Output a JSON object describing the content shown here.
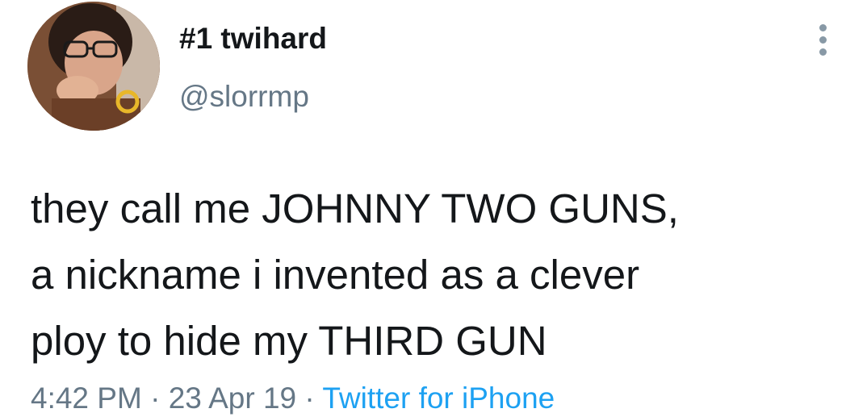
{
  "user": {
    "display_name": "#1 twihard",
    "handle": "@slorrmp",
    "avatar_icon": "user-avatar-photo"
  },
  "tweet": {
    "lines": [
      "they call me JOHNNY TWO GUNS,",
      "a nickname i invented as a clever",
      "ploy to hide my THIRD GUN"
    ],
    "time": "4:42 PM",
    "separator": "·",
    "date": "23 Apr 19",
    "source": "Twitter for iPhone"
  },
  "icons": {
    "more": "vertical-ellipsis-icon"
  },
  "colors": {
    "text": "#14171a",
    "secondary": "#657786",
    "link": "#1da1f2"
  }
}
